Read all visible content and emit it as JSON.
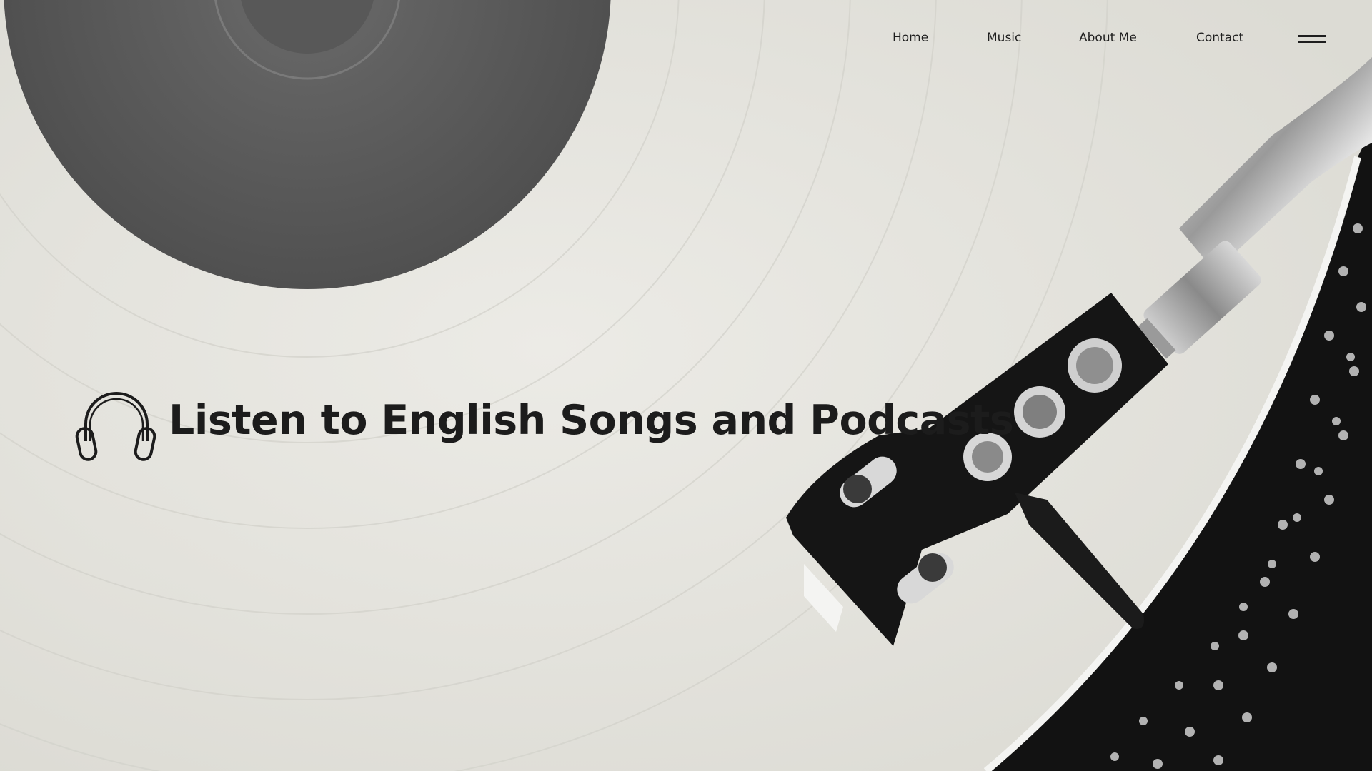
{
  "nav": {
    "links": [
      {
        "label": "Home"
      },
      {
        "label": "Music"
      },
      {
        "label": "About Me"
      },
      {
        "label": "Contact"
      }
    ],
    "menu_icon": "hamburger-menu-icon"
  },
  "hero": {
    "title": "Listen to English Songs and Podcasts",
    "icon": "headphones-icon",
    "background": "turntable-vinyl-photo"
  },
  "colors": {
    "background": "#e4e3dd",
    "text": "#1c1c1c"
  }
}
